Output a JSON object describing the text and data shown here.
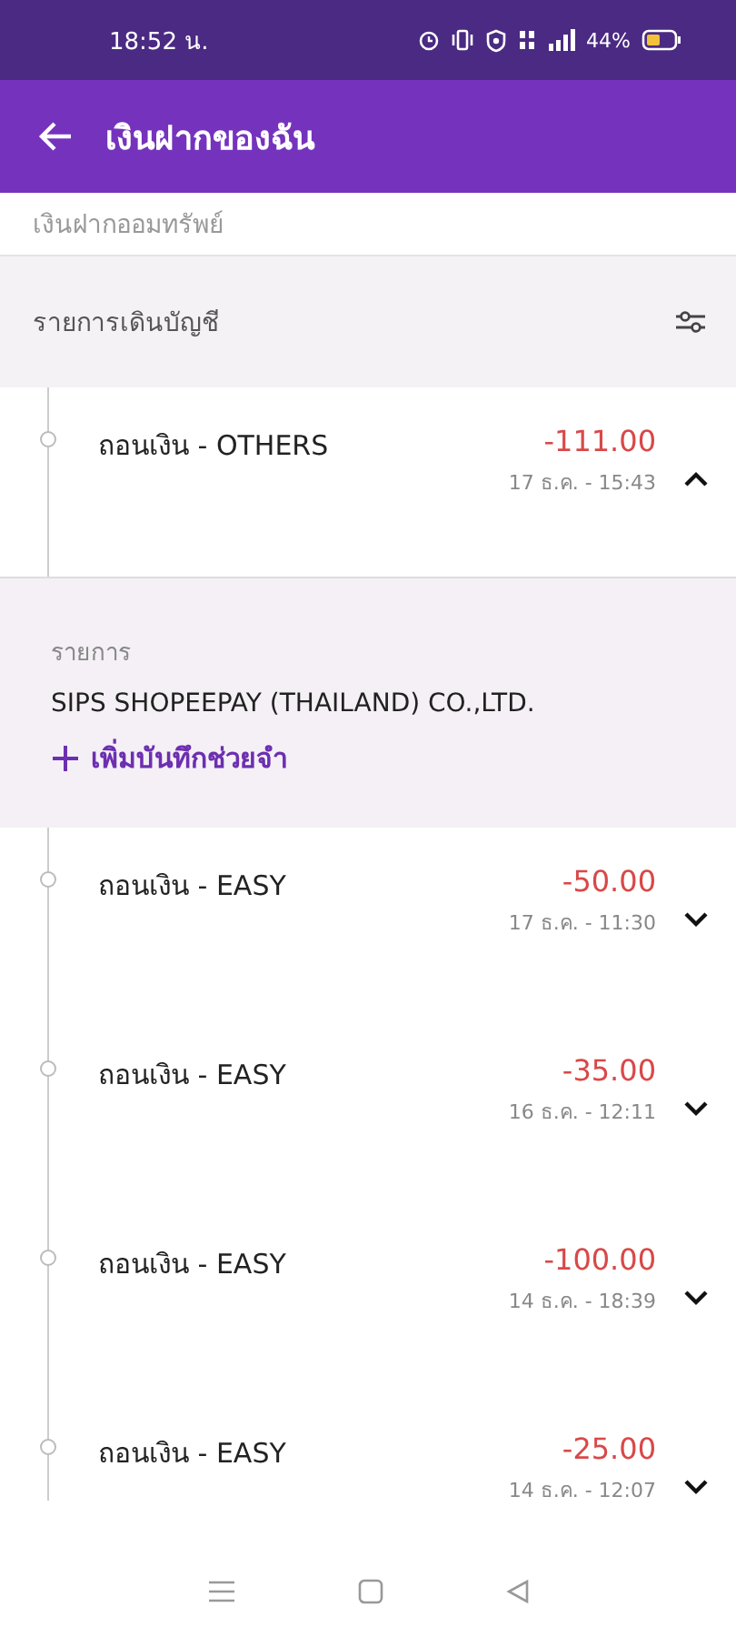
{
  "status_bar": {
    "time": "18:52 น.",
    "battery": "44%"
  },
  "header": {
    "title": "เงินฝากของฉัน"
  },
  "account_name": "เงินฝากออมทรัพย์",
  "section": {
    "title": "รายการเดินบัญชี"
  },
  "transactions": [
    {
      "title": "ถอนเงิน - OTHERS",
      "amount": "-111.00",
      "date": "17 ธ.ค. - 15:43",
      "expanded": true,
      "detail": {
        "label": "รายการ",
        "value": "SIPS SHOPEEPAY (THAILAND) CO.,LTD.",
        "add_note": "เพิ่มบันทึกช่วยจำ"
      }
    },
    {
      "title": "ถอนเงิน - EASY",
      "amount": "-50.00",
      "date": "17 ธ.ค. - 11:30",
      "expanded": false
    },
    {
      "title": "ถอนเงิน - EASY",
      "amount": "-35.00",
      "date": "16 ธ.ค. - 12:11",
      "expanded": false
    },
    {
      "title": "ถอนเงิน - EASY",
      "amount": "-100.00",
      "date": "14 ธ.ค. - 18:39",
      "expanded": false
    },
    {
      "title": "ถอนเงิน - EASY",
      "amount": "-25.00",
      "date": "14 ธ.ค. - 12:07",
      "expanded": false
    }
  ]
}
